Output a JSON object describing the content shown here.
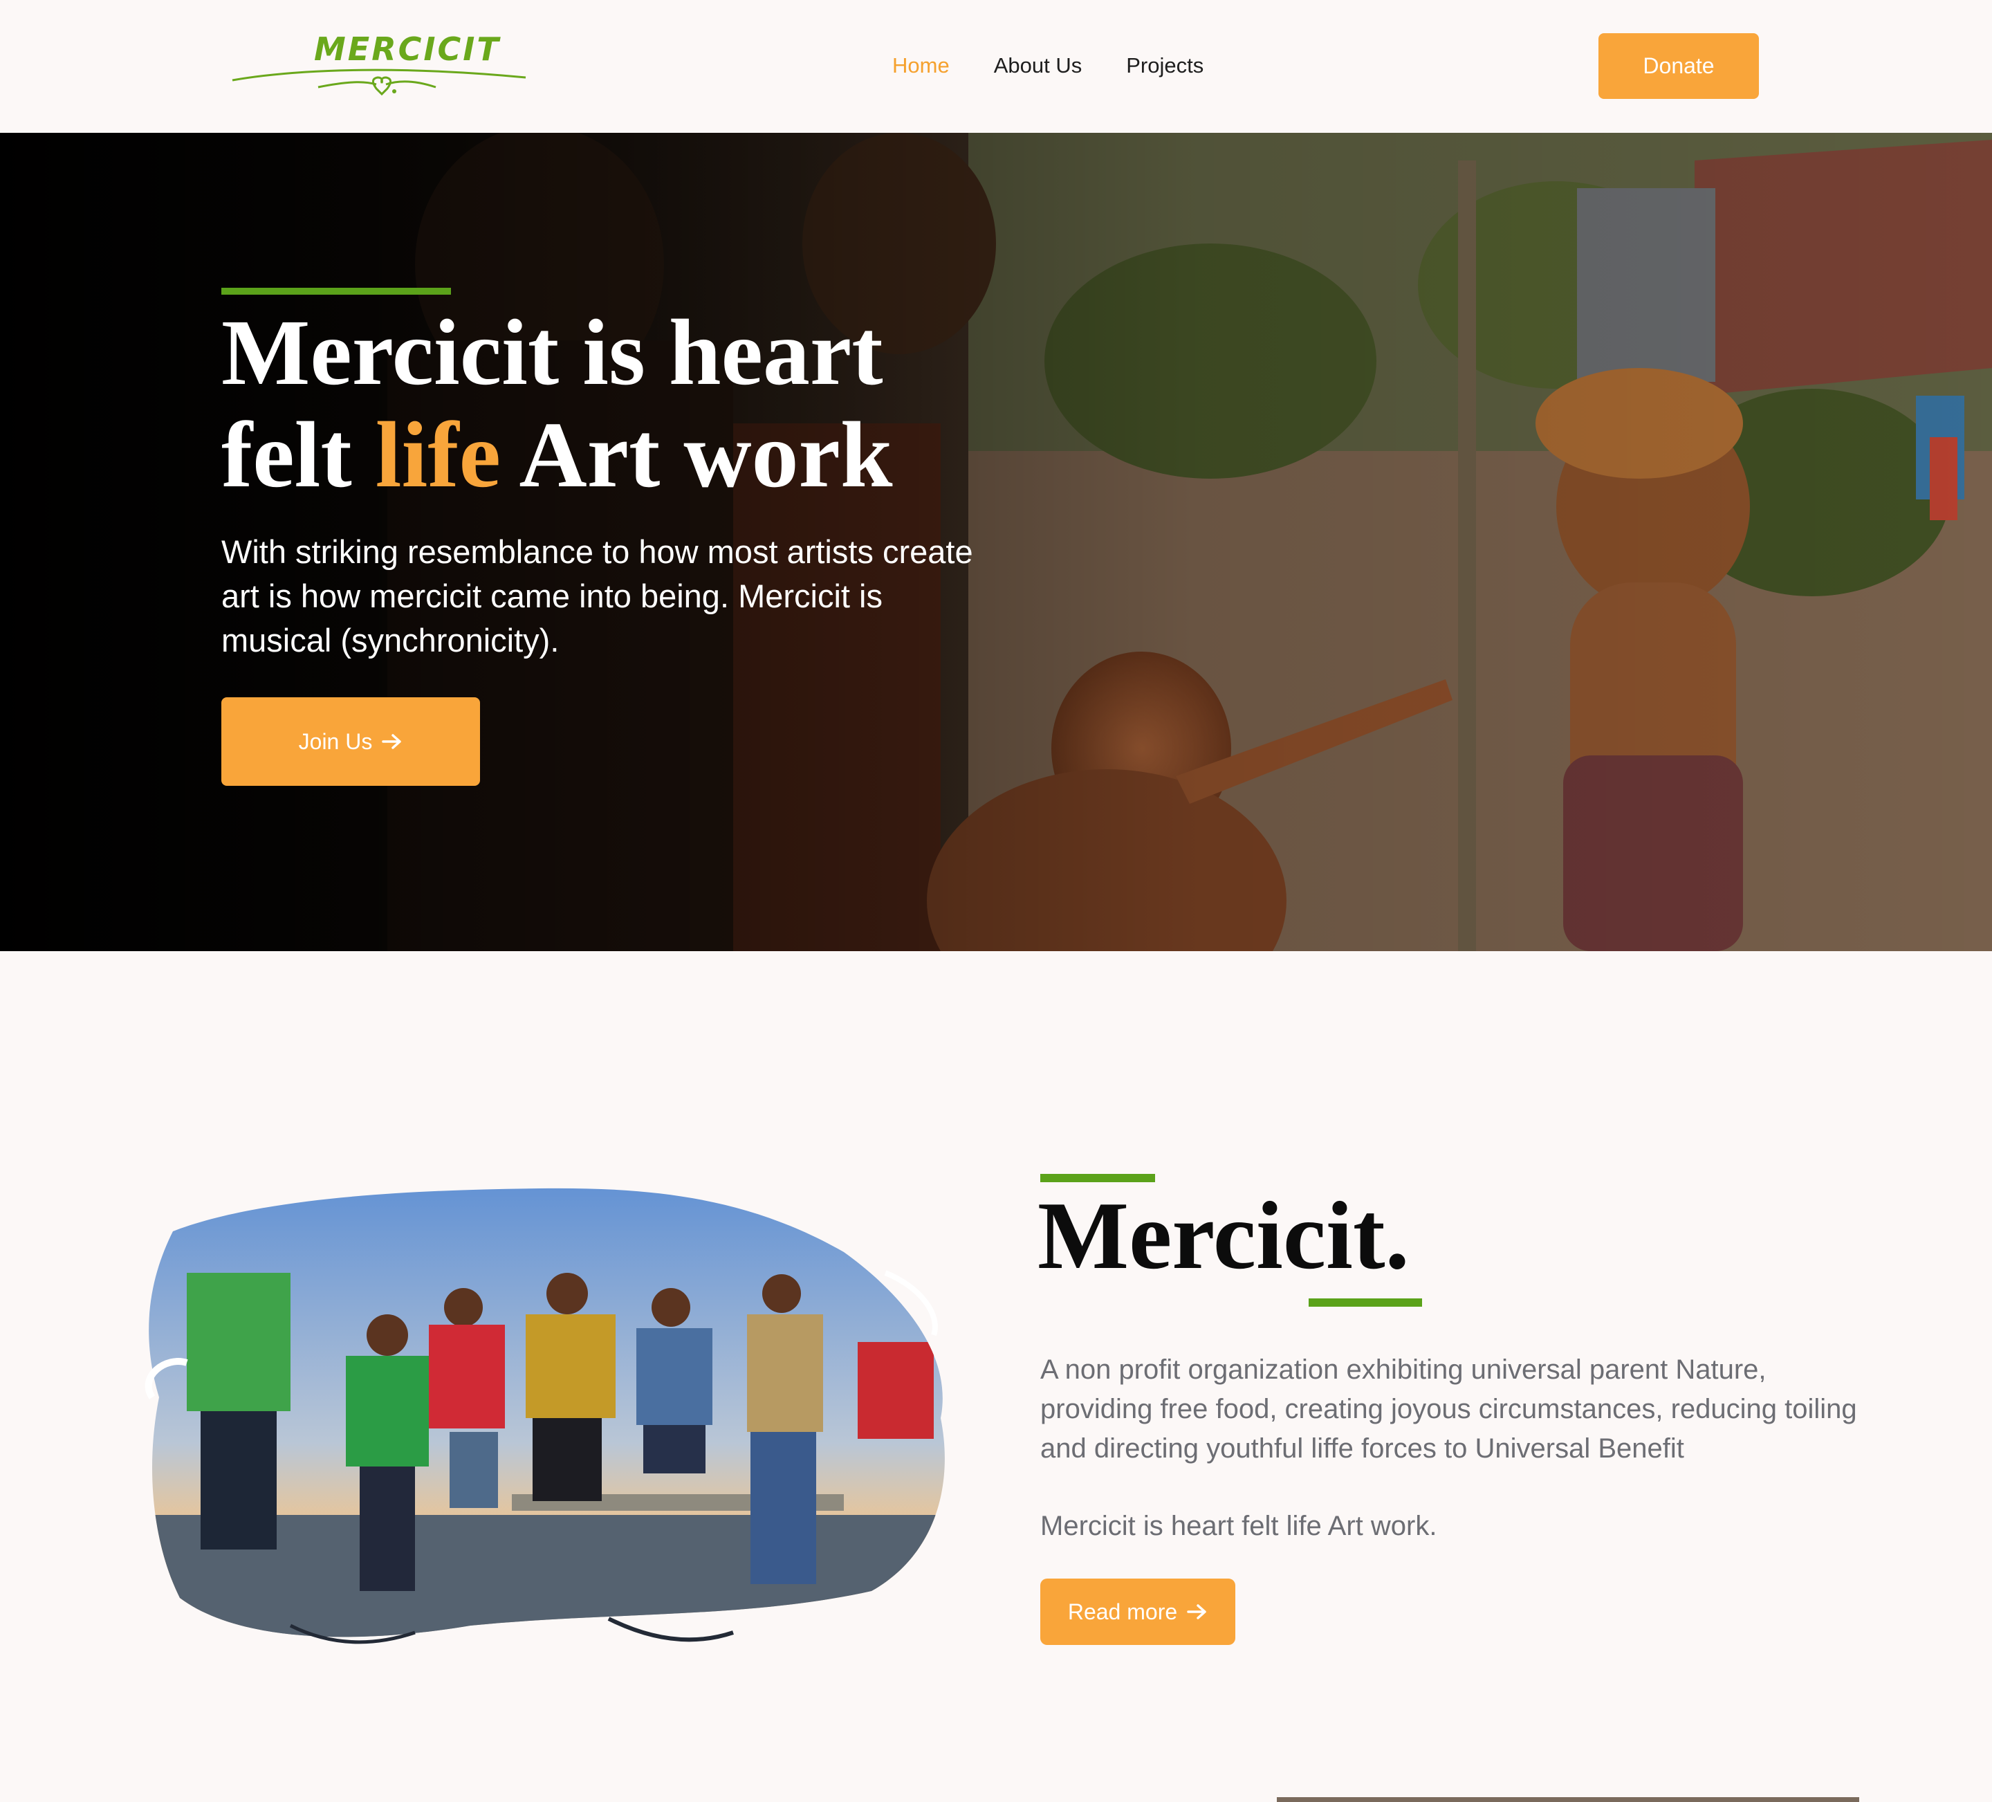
{
  "nav": {
    "logo_text": "MERCICIT",
    "links": [
      {
        "label": "Home",
        "active": true
      },
      {
        "label": "About Us",
        "active": false
      },
      {
        "label": "Projects",
        "active": false
      }
    ],
    "donate_label": "Donate"
  },
  "hero": {
    "title_line1": "Mercicit is heart",
    "title_line2_pre": "felt ",
    "title_line2_highlight": "life",
    "title_line2_post": " Art work",
    "description": "With striking resemblance to how most artists create art is how mercicit came into being. Mercicit is musical (synchronicity).",
    "cta_label": "Join Us",
    "cta_icon": "arrow-right-icon"
  },
  "about": {
    "title": "Mercicit.",
    "description": "A non profit organization exhibiting universal parent Nature, providing free food, creating joyous circumstances, reducing toiling and directing youthful liffe forces to Universal Benefit",
    "tagline": "Mercicit is heart felt life Art work.",
    "cta_label": "Read more",
    "cta_icon": "arrow-right-icon"
  },
  "colors": {
    "accent": "#f9a53a",
    "brand_green": "#5ba21a",
    "background": "#fcf8f7",
    "body_text": "#6c6d73"
  }
}
